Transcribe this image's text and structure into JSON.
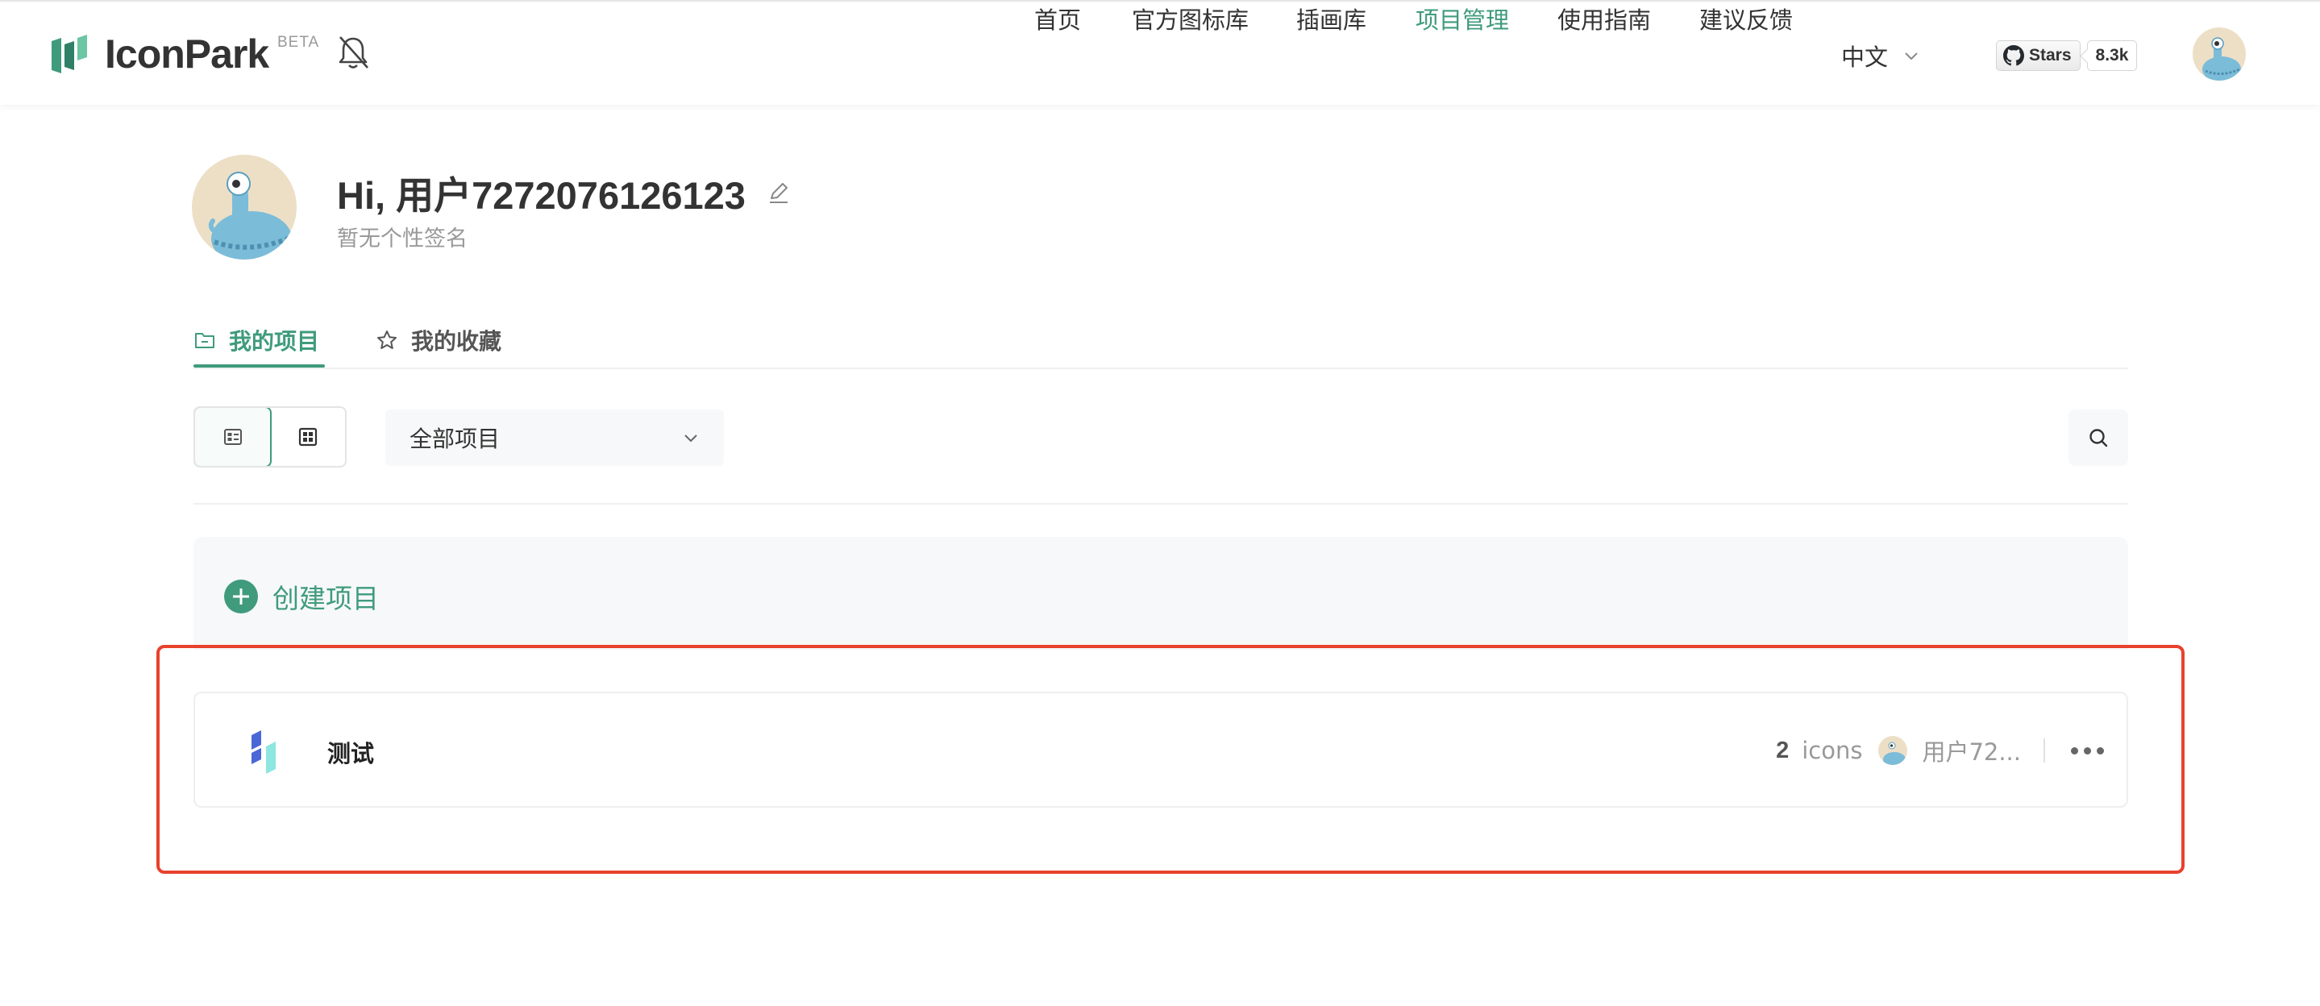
{
  "header": {
    "logo_text": "IconPark",
    "beta_label": "BETA",
    "nav": [
      {
        "label": "首页",
        "active": false
      },
      {
        "label": "官方图标库",
        "active": false
      },
      {
        "label": "插画库",
        "active": false
      },
      {
        "label": "项目管理",
        "active": true
      },
      {
        "label": "使用指南",
        "active": false
      },
      {
        "label": "建议反馈",
        "active": false
      }
    ],
    "language": "中文",
    "github": {
      "stars_label": "Stars",
      "count": "8.3k"
    }
  },
  "profile": {
    "greeting": "Hi, 用户7272076126123",
    "signature": "暂无个性签名"
  },
  "tabs": [
    {
      "label": "我的项目",
      "icon": "folder-icon",
      "active": true
    },
    {
      "label": "我的收藏",
      "icon": "star-icon",
      "active": false
    }
  ],
  "toolbar": {
    "view_modes": [
      "list-view-icon",
      "grid-view-icon"
    ],
    "active_view": "list-view-icon",
    "filter_value": "全部项目"
  },
  "create_label": "创建项目",
  "projects": [
    {
      "name": "测试",
      "icon_count": "2",
      "icon_word": "icons",
      "owner": "用户72..."
    }
  ],
  "colors": {
    "accent": "#3f9b7c",
    "highlight": "#e8412c"
  }
}
